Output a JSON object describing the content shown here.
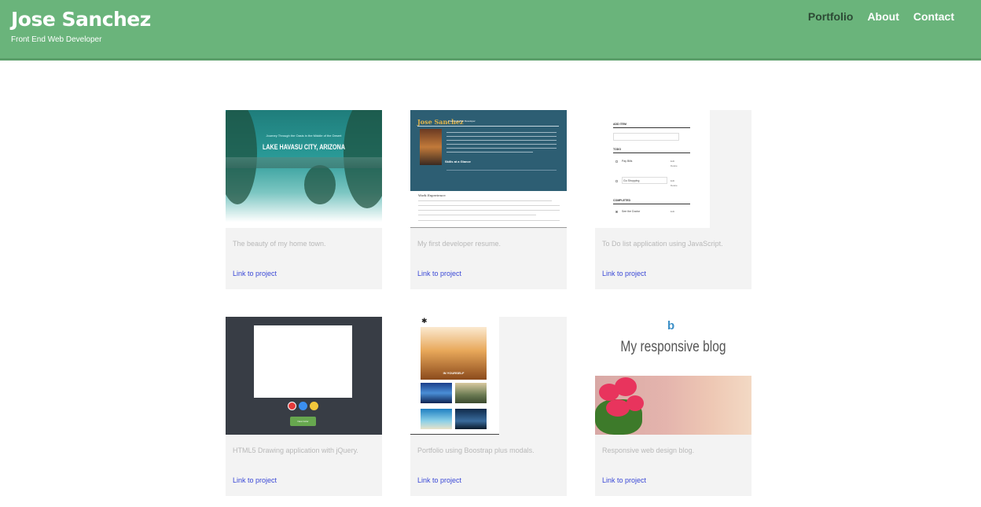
{
  "header": {
    "name": "Jose Sanchez",
    "tagline": "Front End Web Developer",
    "nav": [
      "Portfolio",
      "About",
      "Contact"
    ]
  },
  "colors": {
    "header_bg": "#6ab47b",
    "nav_active": "#2d4a35",
    "link": "#3b49d6",
    "card_bg": "#f3f3f3"
  },
  "projects": [
    {
      "description": "The beauty of my home town.",
      "link": "Link to project",
      "thumb": {
        "subtitle": "Journey Through the Oasis in the Middle of the Desert",
        "title": "LAKE HAVASU CITY, ARIZONA"
      }
    },
    {
      "description": "My first developer resume.",
      "link": "Link to project",
      "thumb": {
        "name": "Jose Sanchez",
        "tagline": "Front End Web Developer",
        "skills": "Skills at a Glance",
        "work": "Work Experience"
      }
    },
    {
      "description": "To Do list application using JavaScript.",
      "link": "Link to project",
      "thumb": {
        "add": "ADD ITEM",
        "todo": "TODO",
        "completed": "COMPLETED",
        "items": [
          "Pay Bills",
          "Go Shopping",
          "See the Doctor"
        ],
        "edit": "Edit",
        "delete": "Delete"
      }
    },
    {
      "description": "HTML5 Drawing application with jQuery.",
      "link": "Link to project",
      "thumb": {
        "button": "New Color"
      }
    },
    {
      "description": "Portfolio using Boostrap plus modals.",
      "link": "Link to project",
      "thumb": {
        "hero": "IN YOURSELF"
      }
    },
    {
      "description": "Responsive web design blog.",
      "link": "Link to project",
      "thumb": {
        "logo": "b",
        "title": "My responsive blog"
      }
    }
  ]
}
